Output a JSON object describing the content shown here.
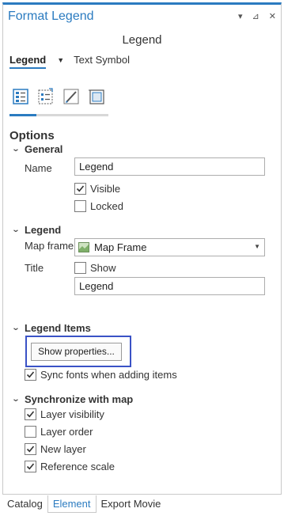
{
  "window": {
    "title": "Format Legend",
    "buttons": [
      "▾",
      "⊿",
      "✕"
    ]
  },
  "subtitle": "Legend",
  "tabs": {
    "active": "Legend",
    "other": "Text Symbol"
  },
  "options_heading": "Options",
  "general": {
    "heading": "General",
    "name_label": "Name",
    "name_value": "Legend",
    "visible_label": "Visible",
    "visible_checked": true,
    "locked_label": "Locked",
    "locked_checked": false
  },
  "legend": {
    "heading": "Legend",
    "map_frame_label": "Map frame",
    "map_frame_value": "Map Frame",
    "title_label": "Title",
    "show_label": "Show",
    "show_checked": false,
    "title_value": "Legend"
  },
  "legend_items": {
    "heading": "Legend Items",
    "show_properties_label": "Show properties...",
    "sync_fonts_label": "Sync fonts when adding items",
    "sync_fonts_checked": true
  },
  "sync_map": {
    "heading": "Synchronize with map",
    "items": [
      {
        "label": "Layer visibility",
        "checked": true
      },
      {
        "label": "Layer order",
        "checked": false
      },
      {
        "label": "New layer",
        "checked": true
      },
      {
        "label": "Reference scale",
        "checked": true
      }
    ]
  },
  "bottom_tabs": [
    "Catalog",
    "Element",
    "Export Movie"
  ],
  "colors": {
    "accent": "#2b7bc0",
    "highlight_box": "#3a52c6"
  }
}
